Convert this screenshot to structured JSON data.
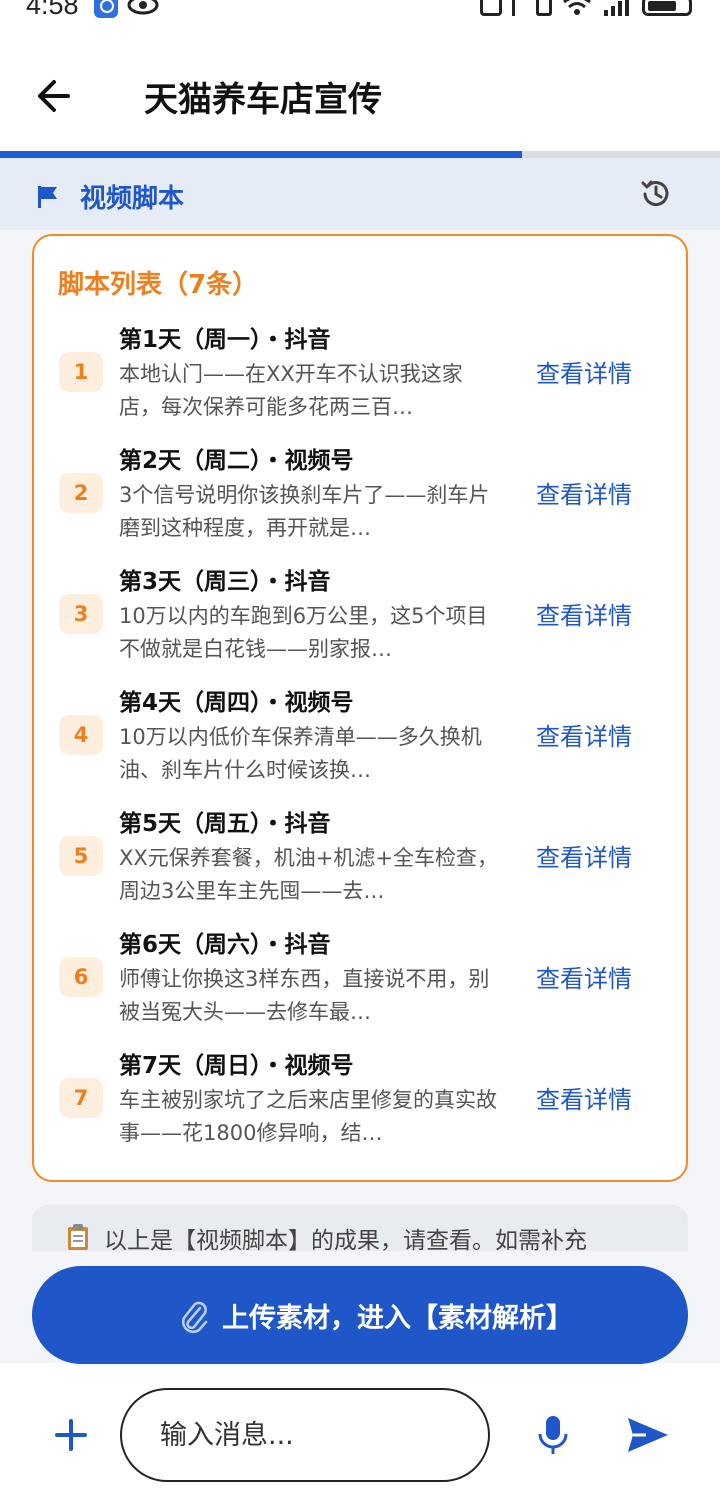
{
  "status_bar": {
    "time": "4:58"
  },
  "header": {
    "title": "天猫养车店宣传"
  },
  "progress": {
    "fraction": 0.725
  },
  "section": {
    "title": "视频脚本"
  },
  "card": {
    "title": "脚本列表（7条）",
    "items": [
      {
        "num": "1",
        "heading": "第1天（周一）・抖音",
        "desc": "本地认门——在XX开车不认识我这家店，每次保养可能多花两三百…",
        "link": "查看详情"
      },
      {
        "num": "2",
        "heading": "第2天（周二）・视频号",
        "desc": "3个信号说明你该换刹车片了——刹车片磨到这种程度，再开就是…",
        "link": "查看详情"
      },
      {
        "num": "3",
        "heading": "第3天（周三）・抖音",
        "desc": "10万以内的车跑到6万公里，这5个项目不做就是白花钱——别家报…",
        "link": "查看详情"
      },
      {
        "num": "4",
        "heading": "第4天（周四）・视频号",
        "desc": "10万以内低价车保养清单——多久换机油、刹车片什么时候该换…",
        "link": "查看详情"
      },
      {
        "num": "5",
        "heading": "第5天（周五）・抖音",
        "desc": "XX元保养套餐，机油+机滤+全车检查，周边3公里车主先囤——去…",
        "link": "查看详情"
      },
      {
        "num": "6",
        "heading": "第6天（周六）・抖音",
        "desc": "师傅让你换这3样东西，直接说不用，别被当冤大头——去修车最…",
        "link": "查看详情"
      },
      {
        "num": "7",
        "heading": "第7天（周日）・视频号",
        "desc": "车主被别家坑了之后来店里修复的真实故事——花1800修异响，结…",
        "link": "查看详情"
      }
    ]
  },
  "note": {
    "text": "以上是【视频脚本】的成果，请查看。如需补充"
  },
  "upload_button": {
    "label": "上传素材，进入【素材解析】"
  },
  "input_bar": {
    "placeholder": "输入消息..."
  },
  "colors": {
    "accent_blue": "#1f56c8",
    "accent_orange": "#ee7f1f",
    "section_bg": "#e6ecf6"
  },
  "icons": [
    "back-arrow-icon",
    "flag-icon",
    "history-icon",
    "clipboard-icon",
    "paperclip-icon",
    "plus-icon",
    "microphone-icon",
    "send-icon"
  ]
}
